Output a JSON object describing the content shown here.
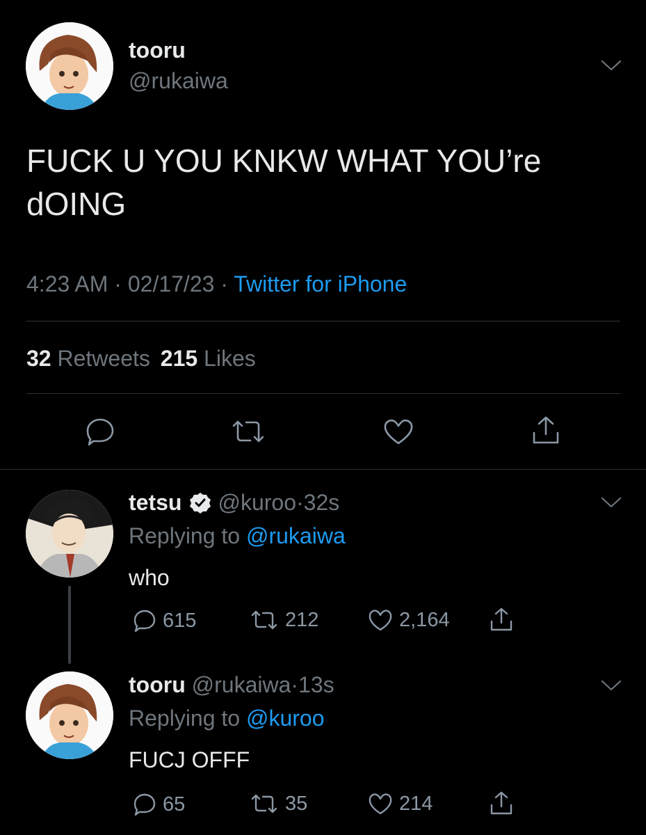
{
  "main_tweet": {
    "name": "tooru",
    "handle": "@rukaiwa",
    "text_line1": "FUCK U YOU KNKW WHAT YOU’re",
    "text_line2": "dOING",
    "time": "4:23 AM",
    "date": "02/17/23",
    "client": "Twitter for iPhone",
    "retweets_count": "32",
    "retweets_label": "Retweets",
    "likes_count": "215",
    "likes_label": "Likes"
  },
  "replies": [
    {
      "name": "tetsu",
      "verified": true,
      "handle": "@kuroo",
      "time": "32s",
      "replying_label": "Replying to",
      "replying_to": "@rukaiwa",
      "text": "who",
      "replies": "615",
      "retweets": "212",
      "likes": "2,164"
    },
    {
      "name": "tooru",
      "handle": "@rukaiwa",
      "time": "13s",
      "replying_label": "Replying to",
      "replying_to": "@kuroo",
      "text": "FUCJ OFFF",
      "replies": "65",
      "retweets": "35",
      "likes": "214"
    }
  ],
  "colors": {
    "background": "#000000",
    "text": "#e7e9ea",
    "muted": "#6e767d",
    "link": "#1d9bf0"
  },
  "icons": [
    "chevron-down-icon",
    "reply-icon",
    "retweet-icon",
    "like-icon",
    "share-icon",
    "verified-icon"
  ]
}
